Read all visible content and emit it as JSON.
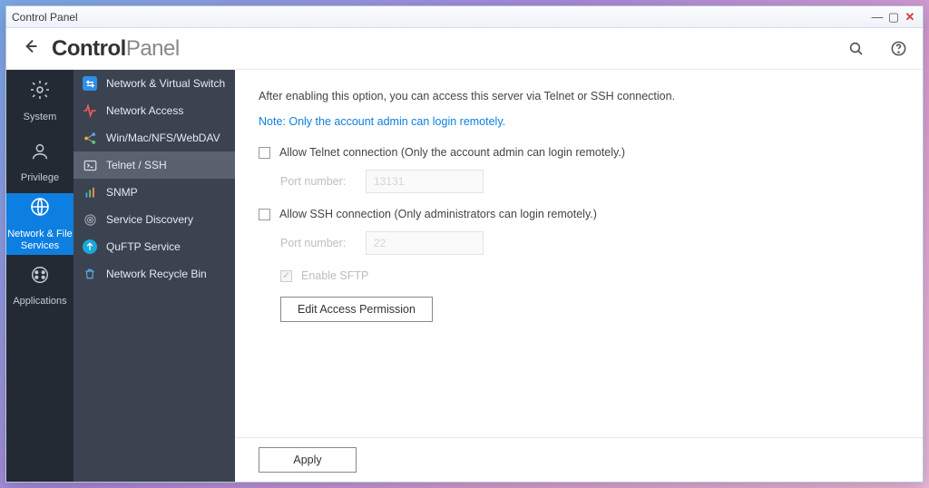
{
  "window": {
    "title": "Control Panel"
  },
  "header": {
    "brand_bold": "Control",
    "brand_light": "Panel"
  },
  "nav1": {
    "items": [
      {
        "label": "System"
      },
      {
        "label": "Privilege"
      },
      {
        "label": "Network & File Services"
      },
      {
        "label": "Applications"
      }
    ],
    "active_index": 2
  },
  "nav2": {
    "items": [
      {
        "label": "Network & Virtual Switch"
      },
      {
        "label": "Network Access"
      },
      {
        "label": "Win/Mac/NFS/WebDAV"
      },
      {
        "label": "Telnet / SSH"
      },
      {
        "label": "SNMP"
      },
      {
        "label": "Service Discovery"
      },
      {
        "label": "QuFTP Service"
      },
      {
        "label": "Network Recycle Bin"
      }
    ],
    "active_index": 3
  },
  "main": {
    "intro": "After enabling this option, you can access this server via Telnet or SSH connection.",
    "note": "Note: Only the account admin can login remotely.",
    "telnet_label": "Allow Telnet connection (Only the account admin can login remotely.)",
    "telnet_port_label": "Port number:",
    "telnet_port_placeholder": "13131",
    "ssh_label": "Allow SSH connection (Only administrators can login remotely.)",
    "ssh_port_label": "Port number:",
    "ssh_port_placeholder": "22",
    "sftp_label": "Enable SFTP",
    "edit_button": "Edit Access Permission",
    "apply_button": "Apply"
  }
}
